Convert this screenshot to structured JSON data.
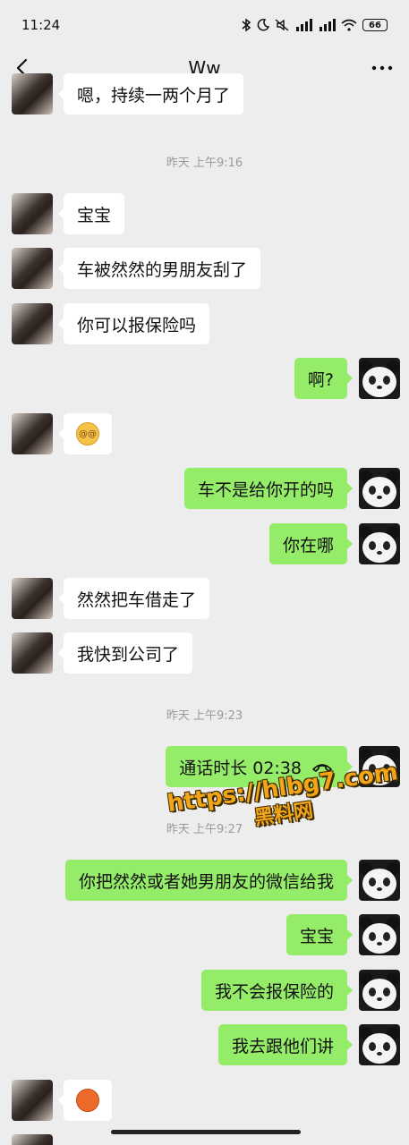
{
  "status_bar": {
    "time": "11:24",
    "icons": [
      "bluetooth-icon",
      "moon-icon",
      "mute-icon",
      "signal-hd-icon",
      "signal-hd-icon",
      "wifi-icon"
    ],
    "battery": "66"
  },
  "nav": {
    "title": "Ww",
    "back_icon": "chevron-left-icon",
    "more_icon": "more-dots-icon"
  },
  "messages": [
    {
      "side": "left",
      "text": "嗯，持续一两个月了"
    },
    {
      "type": "timestamp",
      "text": "昨天 上午9:16"
    },
    {
      "side": "left",
      "text": "宝宝"
    },
    {
      "side": "left",
      "text": "车被然然的男朋友刮了"
    },
    {
      "side": "left",
      "text": "你可以报保险吗"
    },
    {
      "side": "right",
      "text": "啊?"
    },
    {
      "side": "left",
      "emoji": "dizzy-face-emoji"
    },
    {
      "side": "right",
      "text": "车不是给你开的吗"
    },
    {
      "side": "right",
      "text": "你在哪"
    },
    {
      "side": "left",
      "text": "然然把车借走了"
    },
    {
      "side": "left",
      "text": "我快到公司了"
    },
    {
      "type": "timestamp",
      "text": "昨天 上午9:23"
    },
    {
      "side": "right",
      "type": "call",
      "text": "通话时长 02:38"
    },
    {
      "type": "timestamp",
      "text": "昨天 上午9:27"
    },
    {
      "side": "right",
      "text": "你把然然或者她男朋友的微信给我"
    },
    {
      "side": "right",
      "text": "宝宝"
    },
    {
      "side": "right",
      "text": "我不会报保险的"
    },
    {
      "side": "right",
      "text": "我去跟他们讲"
    },
    {
      "side": "left",
      "emoji": "angry-face-emoji"
    }
  ],
  "watermark": {
    "url": "https://hlbg7.com",
    "label": "黑料网"
  },
  "colors": {
    "background": "#ededed",
    "left_bubble": "#ffffff",
    "right_bubble": "#95ec69"
  }
}
